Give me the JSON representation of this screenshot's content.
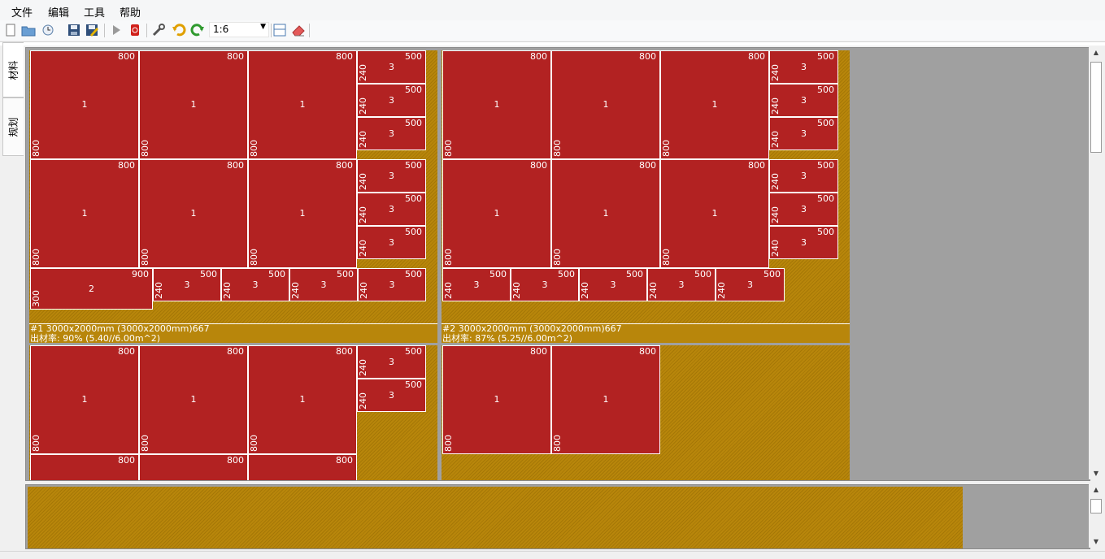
{
  "menu": [
    "文件",
    "编辑",
    "工具",
    "帮助"
  ],
  "toolbar": {
    "buttons": [
      "new-icon",
      "open-icon",
      "recent-icon",
      "save-icon",
      "save-as-icon",
      "run-icon",
      "stop-icon",
      "settings-icon",
      "undo-icon",
      "redo-icon",
      "layout-icon",
      "eraser-icon"
    ],
    "zoom_value": "1:6"
  },
  "side_tabs": [
    "材料",
    "规划"
  ],
  "colors": {
    "piece": "#b22222",
    "sheet": "#b8860b",
    "canvas": "#a0a0a0"
  },
  "sheets": [
    {
      "label": "#1 3000x2000mm (3000x2000mm)667",
      "yield": "出材率: 90% (5.40//6.00m^2)"
    },
    {
      "label": "#2 3000x2000mm (3000x2000mm)667",
      "yield": "出材率: 87% (5.25//6.00m^2)"
    }
  ],
  "piece_types": {
    "1": {
      "w": "800",
      "h": "800",
      "id": "1"
    },
    "2": {
      "w": "900",
      "h": "300",
      "id": "2"
    },
    "3": {
      "w": "500",
      "h": "240",
      "id": "3"
    }
  }
}
